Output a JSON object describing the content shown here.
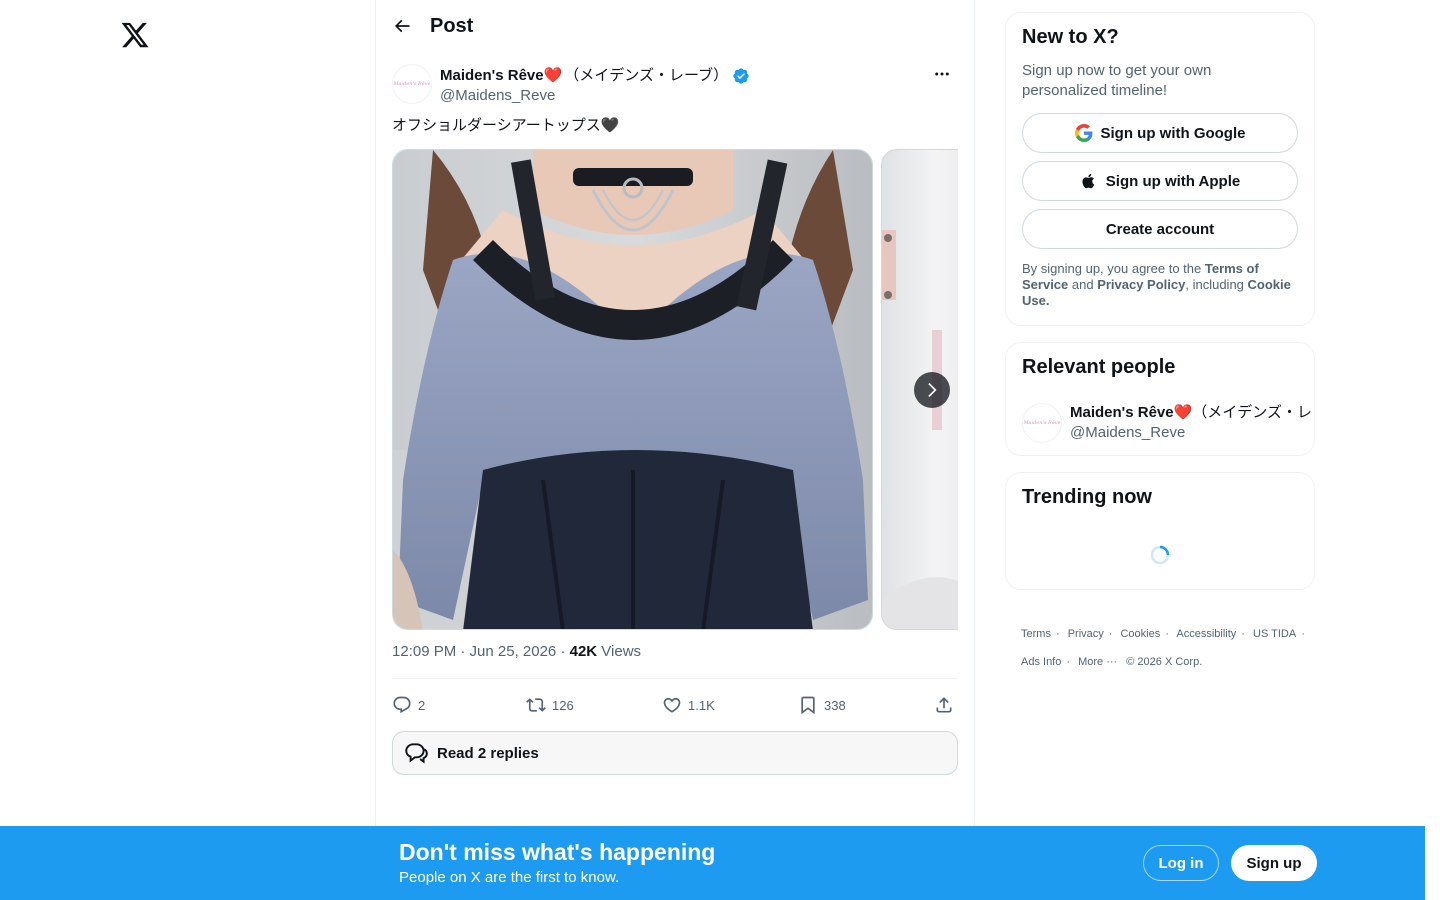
{
  "nav": {
    "logo_icon": "x-logo-icon"
  },
  "header": {
    "title": "Post"
  },
  "post": {
    "author_name": "Maiden's Rêve❤️",
    "author_name_jp": "（メイデンズ・レーブ）",
    "author_handle": "@Maidens_Reve",
    "avatar_text": "Maiden's Rêve",
    "text": "オフショルダーシアートップス🖤",
    "time": "12:09 PM · Jun 25, 2026 · ",
    "views_count": "42K",
    "views_label": " Views",
    "replies": "2",
    "reposts": "126",
    "likes": "1.1K",
    "bookmarks": "338",
    "read_replies": "Read 2 replies"
  },
  "sidebar": {
    "new_to_x": {
      "title": "New to X?",
      "subtitle": "Sign up now to get your own personalized timeline!",
      "google": "Sign up with Google",
      "apple": "Sign up with Apple",
      "create": "Create account",
      "legal_1": "By signing up, you agree to the ",
      "terms": "Terms of Service",
      "legal_2": " and ",
      "privacy": "Privacy Policy",
      "legal_3": ", including ",
      "cookie": "Cookie Use."
    },
    "relevant": {
      "title": "Relevant people",
      "name": "Maiden's Rêve❤️",
      "name_jp": "（メイデンズ・レ",
      "handle": "@Maidens_Reve"
    },
    "trending": {
      "title": "Trending now"
    },
    "footer": [
      "Terms",
      "Privacy",
      "Cookies",
      "Accessibility",
      "US TIDA",
      "Ads Info",
      "More ···",
      "© 2026 X Corp."
    ]
  },
  "banner": {
    "title": "Don't miss what's happening",
    "subtitle": "People on X are the first to know.",
    "login": "Log in",
    "signup": "Sign up"
  },
  "colors": {
    "accent": "#1d9bf0",
    "text": "#0f1419",
    "muted": "#536471"
  }
}
